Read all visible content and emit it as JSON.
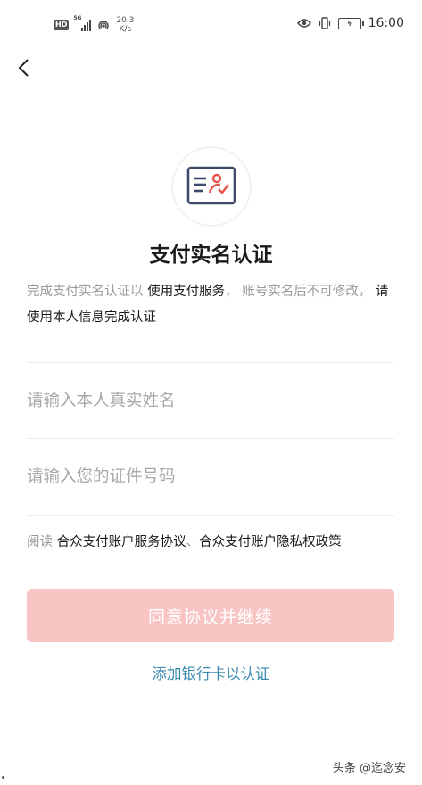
{
  "status_bar": {
    "hd_label": "HD",
    "network_label": "5G",
    "net_speed_value": "20.3",
    "net_speed_unit": "K/s",
    "time": "16:00",
    "icons": [
      "eye-icon",
      "vibrate-icon",
      "battery-charging-icon"
    ]
  },
  "header": {
    "back_icon": "chevron-left-icon"
  },
  "badge": {
    "icon": "id-card-verify-icon",
    "accent": "#e8524a",
    "line_color": "#3f4a6b"
  },
  "page": {
    "title": "支付实名认证",
    "desc_part1": "完成支付实名认证以 ",
    "desc_part2": "使用支付服务",
    "desc_part3": "， 账号实名后不可修改， ",
    "desc_part4": "请使用本人信息完成认证"
  },
  "form": {
    "name_placeholder": "请输入本人真实姓名",
    "name_value": "",
    "id_placeholder": "请输入您的证件号码",
    "id_value": ""
  },
  "agreement": {
    "prefix": "阅读 ",
    "link1": "合众支付账户服务协议",
    "sep": "、",
    "link2": "合众支付账户隐私权政策"
  },
  "actions": {
    "primary_label": "同意协议并继续",
    "primary_color": "#f9c4c4",
    "bank_link_label": "添加银行卡以认证",
    "link_color": "#3a8ab0"
  },
  "watermark": "头条 @迄念安"
}
